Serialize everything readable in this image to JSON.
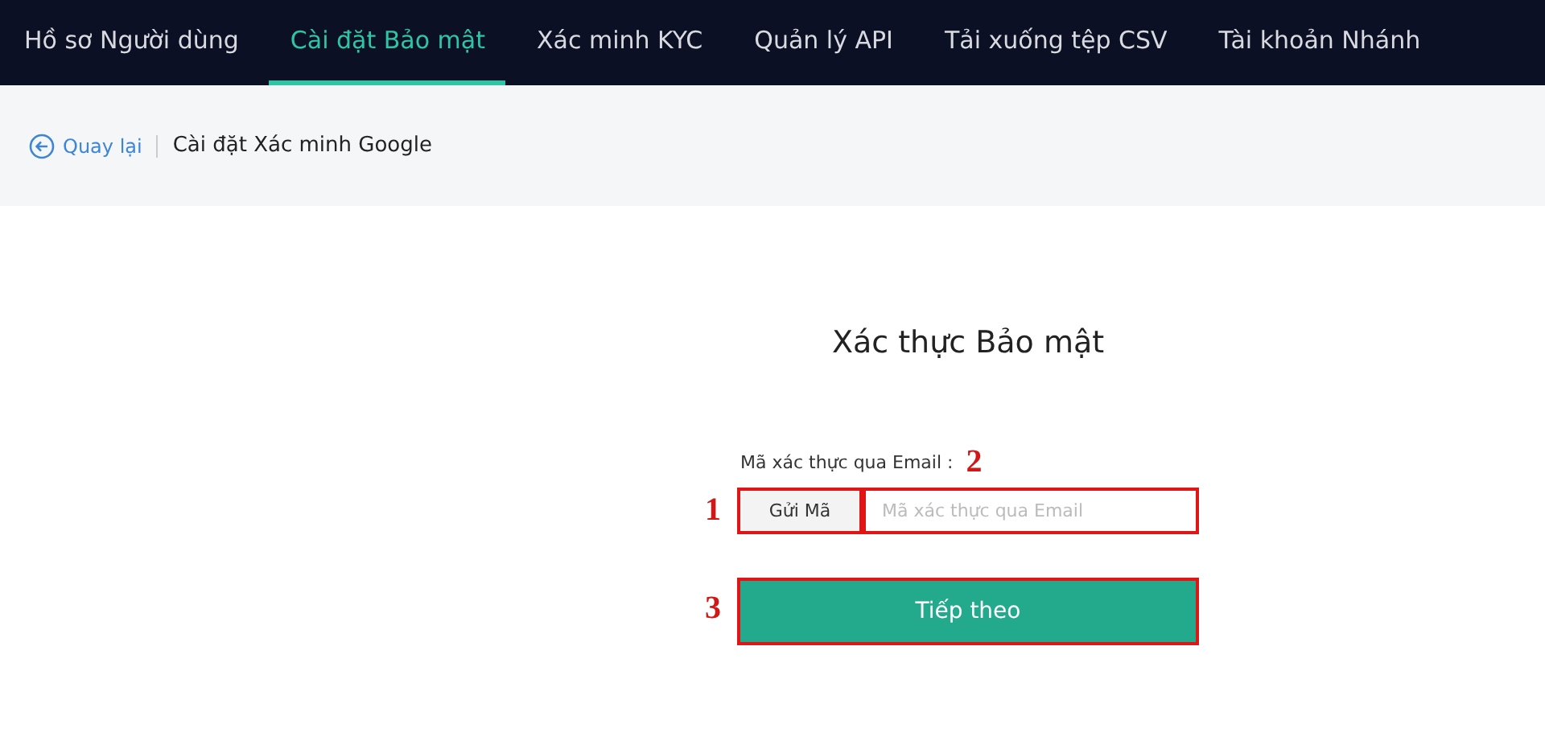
{
  "nav_tabs": [
    {
      "label": "Hồ sơ Người dùng",
      "selected": false
    },
    {
      "label": "Cài đặt Bảo mật",
      "selected": true
    },
    {
      "label": "Xác minh KYC",
      "selected": false
    },
    {
      "label": "Quản lý API",
      "selected": false
    },
    {
      "label": "Tải xuống tệp CSV",
      "selected": false
    },
    {
      "label": "Tài khoản Nhánh",
      "selected": false
    }
  ],
  "breadcrumb": {
    "back_link": "Quay lại",
    "page_title": "Cài đặt Xác minh Google"
  },
  "form": {
    "title": "Xác thực Bảo mật",
    "field_label": {
      "text": "Mã xác thực qua Email :",
      "marker": "2"
    },
    "send_button": {
      "label": "Gửi Mã",
      "marker": "1",
      "highlighted": true
    },
    "code_field": {
      "placeholder": "Mã xác thực qua Email",
      "highlighted": true
    },
    "next_button": {
      "label": "Tiếp theo",
      "marker": "3",
      "highlighted": true
    }
  }
}
